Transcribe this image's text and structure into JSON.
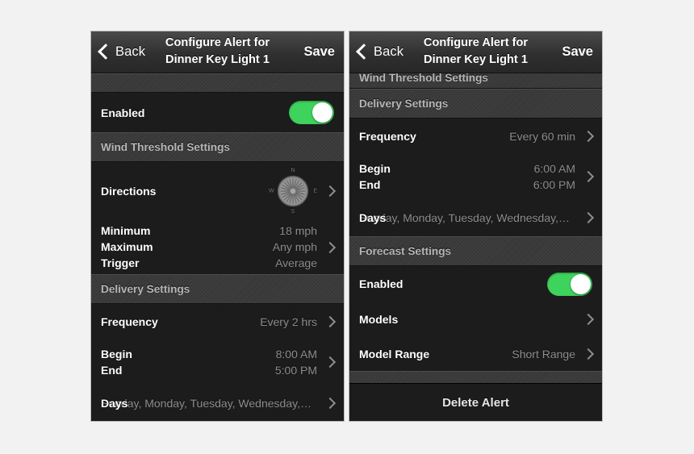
{
  "theme": {
    "page_background": "#f2f2f2",
    "panel_background": "#1c1c1c",
    "accent_green": "#3ed35c",
    "section_header_background": "#3a3a3a",
    "value_text_color": "#8d8d8d"
  },
  "left_panel": {
    "navbar": {
      "back_label": "Back",
      "title_line1": "Configure Alert for",
      "title_line2": "Dinner Key Light 1",
      "save_label": "Save"
    },
    "enabled_row": {
      "label": "Enabled",
      "toggle_state": "on"
    },
    "wind_section": {
      "header": "Wind Threshold Settings",
      "directions_row": {
        "label": "Directions",
        "compass": {
          "north": "N",
          "east": "E",
          "south": "S",
          "west": "W"
        }
      },
      "threshold_row": {
        "labels": [
          "Minimum",
          "Maximum",
          "Trigger"
        ],
        "values": [
          "18 mph",
          "Any mph",
          "Average"
        ]
      }
    },
    "delivery_section": {
      "header": "Delivery Settings",
      "frequency_row": {
        "label": "Frequency",
        "value": "Every 2 hrs"
      },
      "time_row": {
        "labels": [
          "Begin",
          "End"
        ],
        "values": [
          "8:00 AM",
          "5:00 PM"
        ]
      },
      "days_row": {
        "label": "Days",
        "value": "Sunday, Monday, Tuesday, Wednesday, T..."
      }
    }
  },
  "right_panel": {
    "navbar": {
      "back_label": "Back",
      "title_line1": "Configure Alert for",
      "title_line2": "Dinner Key Light 1",
      "save_label": "Save"
    },
    "wind_section_header_clipped": "Wind Threshold Settings",
    "delivery_section": {
      "header": "Delivery Settings",
      "frequency_row": {
        "label": "Frequency",
        "value": "Every 60 min"
      },
      "time_row": {
        "labels": [
          "Begin",
          "End"
        ],
        "values": [
          "6:00 AM",
          "6:00 PM"
        ]
      },
      "days_row": {
        "label": "Days",
        "value": "Sunday, Monday, Tuesday, Wednesday, T..."
      }
    },
    "forecast_section": {
      "header": "Forecast Settings",
      "enabled_row": {
        "label": "Enabled",
        "toggle_state": "on"
      },
      "models_row": {
        "label": "Models"
      },
      "model_range_row": {
        "label": "Model Range",
        "value": "Short Range"
      }
    },
    "delete_button": "Delete Alert"
  }
}
